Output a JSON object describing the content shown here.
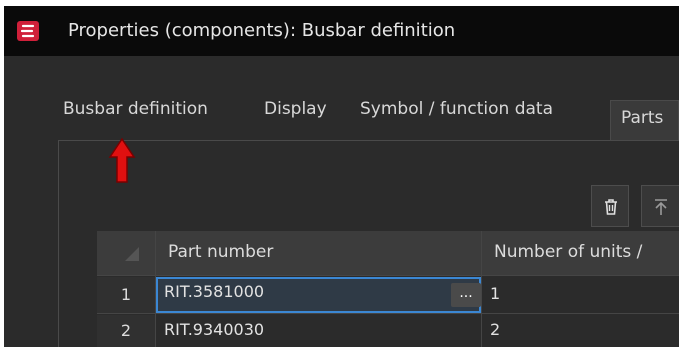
{
  "window": {
    "title": "Properties (components): Busbar definition",
    "app_icon": "app-logo-icon",
    "accent_color": "#d0203a"
  },
  "tabs": [
    {
      "label": "Busbar definition"
    },
    {
      "label": "Display"
    },
    {
      "label": "Symbol / function data"
    },
    {
      "label": "Parts"
    }
  ],
  "toolbar": {
    "delete_icon": "trash-icon",
    "move_top_icon": "move-to-top-icon"
  },
  "grid": {
    "columns": [
      {
        "label": "Part number"
      },
      {
        "label": "Number of units /"
      }
    ],
    "rows": [
      {
        "num": "1",
        "part_number": "RIT.3581000",
        "units": "1",
        "selected": true,
        "ellipsis": "..."
      },
      {
        "num": "2",
        "part_number": "RIT.9340030",
        "units": "2",
        "selected": false
      }
    ]
  },
  "annotation": {
    "arrow_color": "#e01010",
    "points_to": "Busbar definition"
  }
}
